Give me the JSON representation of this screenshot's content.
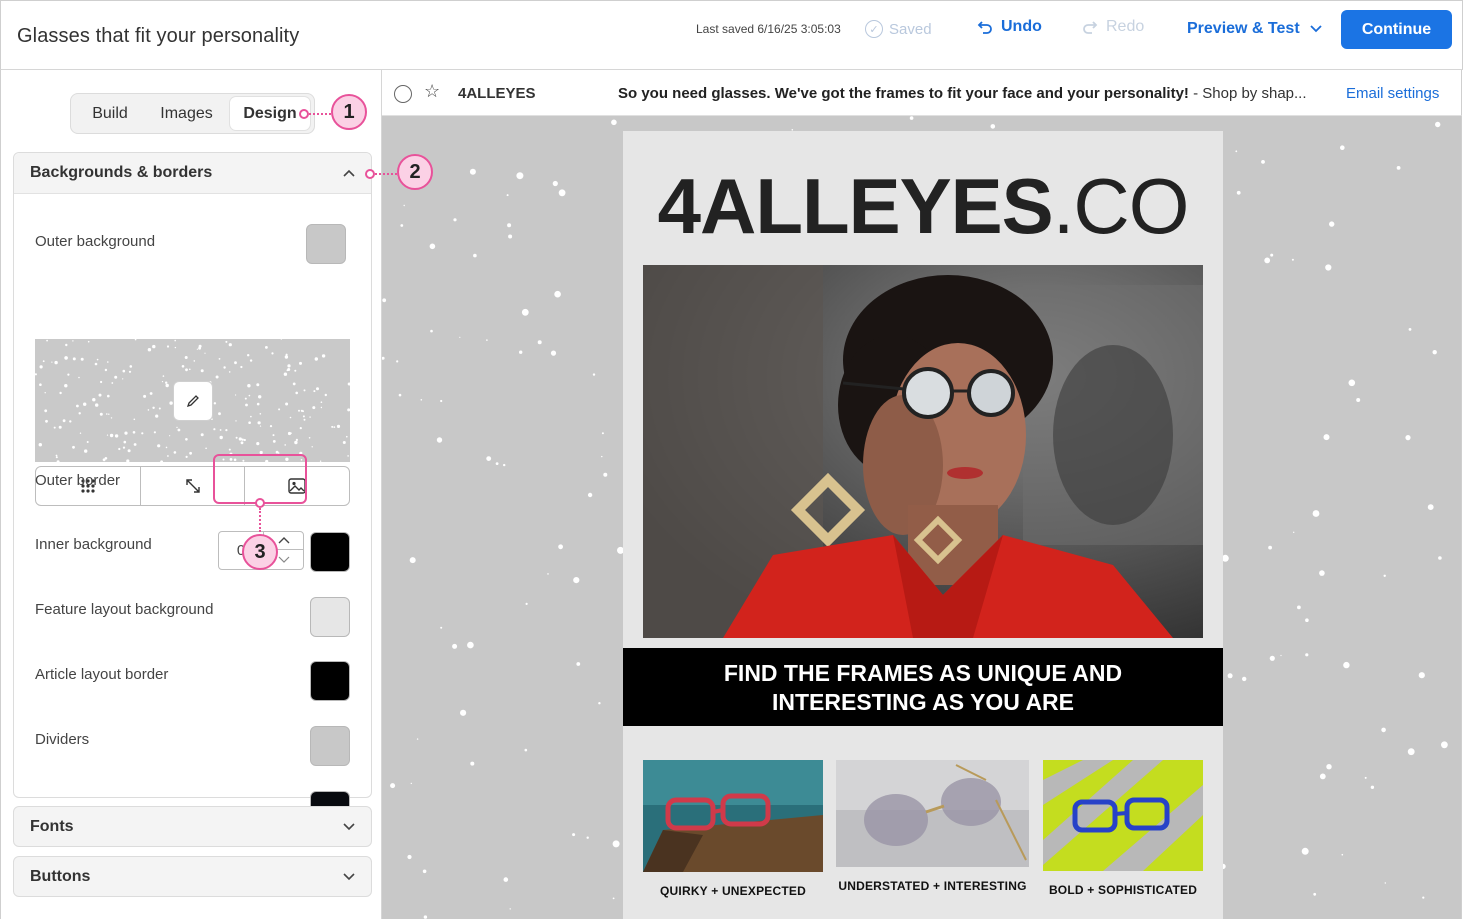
{
  "header": {
    "title": "Glasses that fit your personality",
    "last_saved": "Last saved 6/16/25 3:05:03",
    "saved_label": "Saved",
    "undo_label": "Undo",
    "redo_label": "Redo",
    "preview_label": "Preview & Test",
    "continue_label": "Continue"
  },
  "tabs": [
    {
      "label": "Build"
    },
    {
      "label": "Images"
    },
    {
      "label": "Design",
      "active": true
    }
  ],
  "callouts": [
    "1",
    "2",
    "3"
  ],
  "section": {
    "title": "Backgrounds & borders",
    "rows": {
      "outer_background": {
        "label": "Outer background",
        "color": "#c8c8c8"
      },
      "outer_border": {
        "label": "Outer border",
        "value": "0",
        "color": "#000000"
      },
      "inner_background": {
        "label": "Inner background",
        "color": "#e6e6e6"
      },
      "feature_layout_background": {
        "label": "Feature layout background",
        "color": "#000000"
      },
      "article_layout_border": {
        "label": "Article layout border",
        "color": "#c8c8c8"
      },
      "dividers": {
        "label": "Dividers",
        "color": "#080a0f"
      }
    },
    "image_tools": [
      "grid-icon",
      "resize-icon",
      "image-icon"
    ]
  },
  "accordions": [
    {
      "label": "Fonts"
    },
    {
      "label": "Buttons"
    }
  ],
  "subject_bar": {
    "sender": "4ALLEYES",
    "subject_bold": "So you need glasses. We've got the frames to fit your face and your personality!",
    "subject_rest": " - Shop by shap...",
    "settings_link": "Email settings"
  },
  "email": {
    "logo_bold": "4ALLEYES",
    "logo_light": ".CO",
    "banner_line1": "FIND THE FRAMES AS UNIQUE AND",
    "banner_line2": "INTERESTING AS YOU ARE",
    "products": [
      {
        "label": "QUIRKY + UNEXPECTED"
      },
      {
        "label": "UNDERSTATED + INTERESTING"
      },
      {
        "label": "BOLD + SOPHISTICATED"
      }
    ]
  },
  "colors": {
    "accent": "#1b74e4",
    "callout": "#e8529a"
  }
}
